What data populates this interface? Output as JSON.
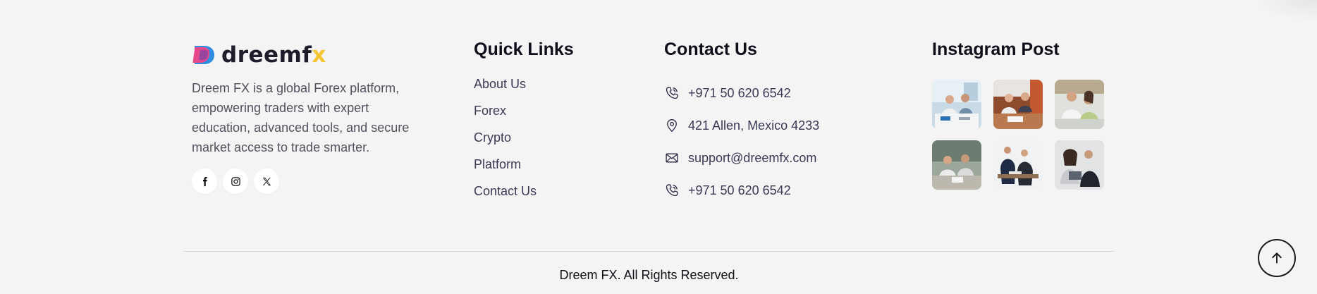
{
  "brand": {
    "logo_text_main": "dreemf",
    "logo_text_accent": "x",
    "description": "Dreem FX is a global Forex platform, empowering traders with expert education, advanced tools, and secure market access to trade smarter.",
    "socials": [
      {
        "icon": "facebook-icon"
      },
      {
        "icon": "instagram-icon"
      },
      {
        "icon": "x-twitter-icon"
      }
    ]
  },
  "quick_links": {
    "title": "Quick Links",
    "items": [
      "About Us",
      "Forex",
      "Crypto",
      "Platform",
      "Contact Us"
    ]
  },
  "contact": {
    "title": "Contact Us",
    "items": [
      {
        "icon": "phone-icon",
        "text": "+971 50 620 6542"
      },
      {
        "icon": "location-pin-icon",
        "text": "421 Allen, Mexico 4233"
      },
      {
        "icon": "mail-icon",
        "text": "support@dreemfx.com"
      },
      {
        "icon": "phone-icon",
        "text": "+971 50 620 6542"
      }
    ]
  },
  "instagram": {
    "title": "Instagram Post"
  },
  "footer": {
    "copyright": "Dreem FX. All Rights Reserved."
  },
  "colors": {
    "background": "#f3f4f3",
    "accent_yellow": "#f4c531",
    "logo_pink": "#e6498a",
    "logo_blue": "#2f8ee0",
    "heading": "#0e0e1a"
  },
  "icons": {
    "back_to_top": "arrow-up-icon"
  }
}
